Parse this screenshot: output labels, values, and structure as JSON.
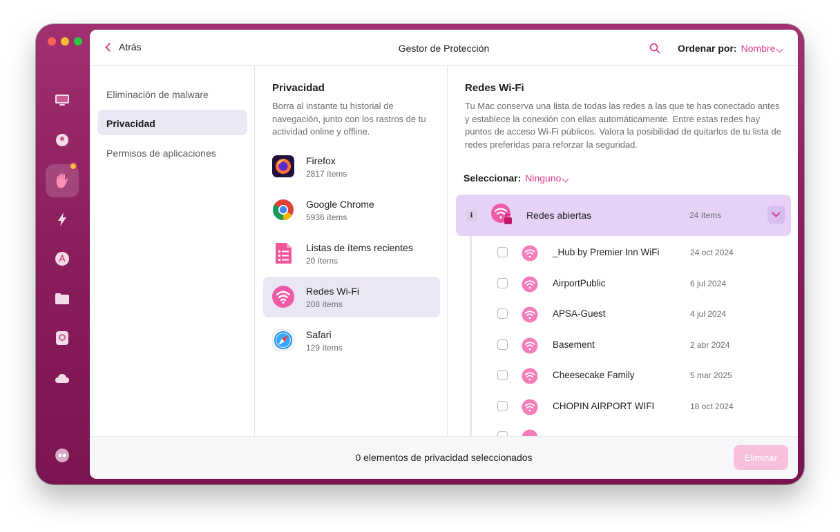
{
  "header": {
    "back_label": "Atrás",
    "title": "Gestor de Protección",
    "sort_label": "Ordenar por:",
    "sort_value": "Nombre"
  },
  "sidebar": {
    "categories": [
      {
        "label": "Eliminación de malware"
      },
      {
        "label": "Privacidad"
      },
      {
        "label": "Permisos de aplicaciones"
      }
    ],
    "active_index": 1
  },
  "privacy": {
    "heading": "Privacidad",
    "description": "Borra al instante tu historial de navegación, junto con los rastros de tu actividad online y offline.",
    "apps": [
      {
        "name": "Firefox",
        "count": "2817 ítems",
        "icon": "firefox-icon"
      },
      {
        "name": "Google Chrome",
        "count": "5936 ítems",
        "icon": "chrome-icon"
      },
      {
        "name": "Listas de ítems recientes",
        "count": "20 ítems",
        "icon": "recent-items-icon"
      },
      {
        "name": "Redes Wi-Fi",
        "count": "208 ítems",
        "icon": "wifi-icon"
      },
      {
        "name": "Safari",
        "count": "129 ítems",
        "icon": "safari-icon"
      }
    ],
    "active_index": 3
  },
  "detail": {
    "heading": "Redes Wi-Fi",
    "description": "Tu Mac conserva una lista de todas las redes a las que te has conectado antes y establece la conexión con ellas automáticamente. Entre estas redes hay puntos de acceso Wi-Fi públicos. Valora la posibilidad de quitarlos de tu lista de redes preferidas para reforzar la seguridad.",
    "select_label": "Seleccionar:",
    "select_value": "Ninguno",
    "group": {
      "name": "Redes abiertas",
      "count": "24 ítems",
      "info": "i"
    },
    "networks": [
      {
        "name": "_Hub by Premier Inn WiFi",
        "date": "24 oct 2024"
      },
      {
        "name": "AirportPublic",
        "date": "6 jul 2024"
      },
      {
        "name": "APSA-Guest",
        "date": "4 jul 2024"
      },
      {
        "name": "Basement",
        "date": "2 abr 2024"
      },
      {
        "name": "Cheesecake Family",
        "date": "5 mar 2025"
      },
      {
        "name": "CHOPIN AIRPORT WIFI",
        "date": "18 oct 2024"
      }
    ]
  },
  "footer": {
    "status": "0 elementos de privacidad seleccionados",
    "delete_label": "Eliminar"
  },
  "colors": {
    "accent": "#d9418f",
    "sidebar_bg": "#8c1f5e",
    "selection_bg": "#ebe6f3",
    "group_bg": "#e6d2f6",
    "delete_disabled": "#f7c1de"
  }
}
